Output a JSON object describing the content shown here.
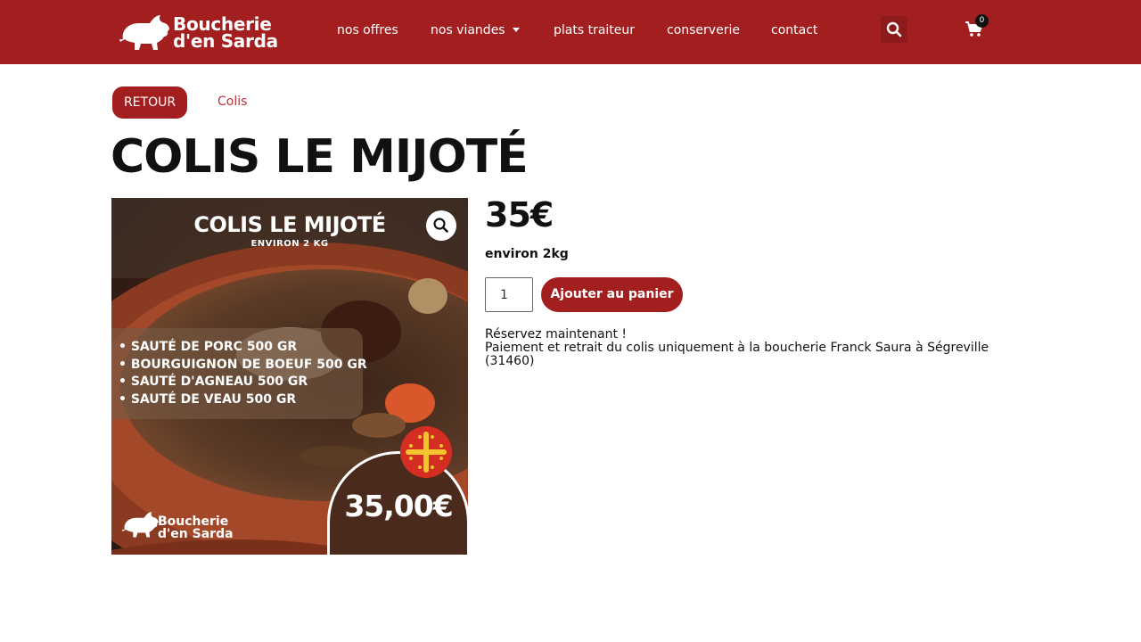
{
  "header": {
    "logo": {
      "line1": "Boucherie",
      "line2": "d'en Sarda"
    },
    "nav": [
      {
        "label": "nos offres"
      },
      {
        "label": "nos viandes"
      },
      {
        "label": "plats traiteur"
      },
      {
        "label": "conserverie"
      },
      {
        "label": "contact"
      }
    ],
    "cart_count": "0",
    "icons": {
      "search": "search-icon",
      "cart": "cart-icon"
    },
    "colors": {
      "brand": "#a31f1f"
    }
  },
  "breadcrumb": {
    "back_label": "RETOUR",
    "category": "Colis"
  },
  "product": {
    "title": "COLIS LE MIJOTÉ",
    "price": "35€",
    "weight": "environ 2kg",
    "quantity": "1",
    "add_to_cart": "Ajouter au panier",
    "description": {
      "line1": "Réservez maintenant !",
      "line2": "Paiement et retrait du colis uniquement à la boucherie Franck Saura à Ségreville",
      "line3": "(31460)"
    },
    "image": {
      "title": "COLIS LE MIJOTÉ",
      "subtitle": "ENVIRON 2 KG",
      "items": [
        "• SAUTÉ DE PORC 500 GR",
        "• BOURGUIGNON DE BOEUF 500 GR",
        "• SAUTÉ D'AGNEAU 500 GR",
        "• SAUTÉ DE VEAU 500 GR"
      ],
      "price": "35,00€",
      "logo_line1": "Boucherie",
      "logo_line2": "d'en Sarda"
    }
  }
}
